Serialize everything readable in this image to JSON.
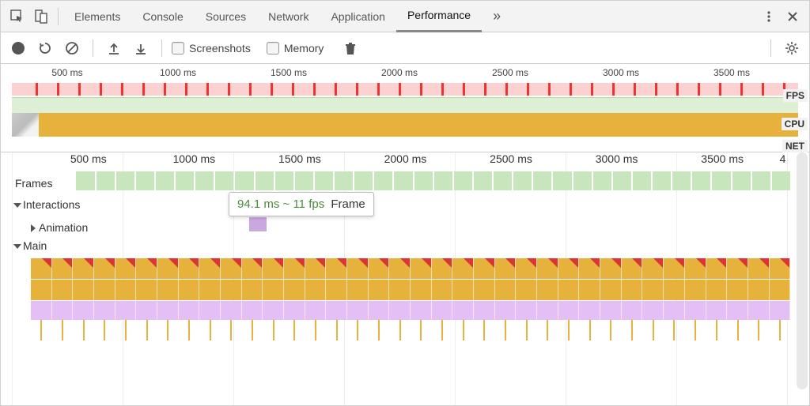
{
  "tabs": {
    "items": [
      "Elements",
      "Console",
      "Sources",
      "Network",
      "Application",
      "Performance"
    ],
    "active_index": 5,
    "overflow_glyph": "»"
  },
  "toolbar": {
    "screenshots_label": "Screenshots",
    "memory_label": "Memory"
  },
  "overview": {
    "ruler": [
      "500 ms",
      "1000 ms",
      "1500 ms",
      "2000 ms",
      "2500 ms",
      "3000 ms",
      "3500 ms"
    ],
    "lanes": {
      "fps": "FPS",
      "cpu": "CPU",
      "net": "NET"
    },
    "red_tick_count": 36
  },
  "detail": {
    "ruler": [
      "500 ms",
      "1000 ms",
      "1500 ms",
      "2000 ms",
      "2500 ms",
      "3000 ms",
      "3500 ms",
      "4"
    ],
    "lanes": {
      "frames": "Frames",
      "interactions": "Interactions",
      "animation": "Animation",
      "main": "Main"
    },
    "frame_count": 36,
    "main_cells": 36,
    "stick_count": 36
  },
  "tooltip": {
    "fps_text": "94.1 ms ~ 11 fps",
    "label": "Frame"
  },
  "chart_data": {
    "type": "area",
    "title": "Performance recording timeline",
    "x_unit": "ms",
    "x_ticks": [
      500,
      1000,
      1500,
      2000,
      2500,
      3000,
      3500
    ],
    "overview_lanes": [
      "FPS",
      "CPU",
      "NET"
    ],
    "frame_hover": {
      "duration_ms": 94.1,
      "fps": 11
    },
    "main_flame_depth": 3,
    "frame_blocks_approx": 36,
    "long_task_markers": true
  }
}
